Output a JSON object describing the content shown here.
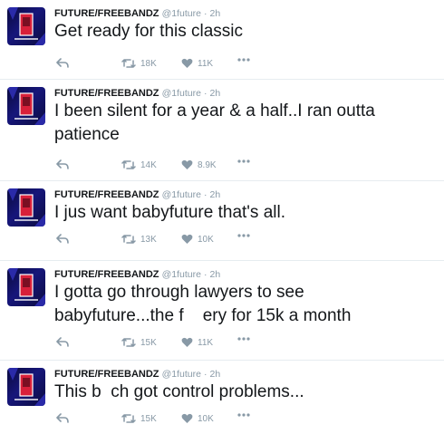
{
  "tweets": [
    {
      "name": "FUTURE/FREEBANDZ",
      "handle": "@1future",
      "separator": "·",
      "time": "2h",
      "text": "Get ready for this classic",
      "retweets": "18K",
      "likes": "11K"
    },
    {
      "name": "FUTURE/FREEBANDZ",
      "handle": "@1future",
      "separator": "·",
      "time": "2h",
      "text": "I been silent for a year & a half..I ran outta\npatience",
      "retweets": "14K",
      "likes": "8.9K"
    },
    {
      "name": "FUTURE/FREEBANDZ",
      "handle": "@1future",
      "separator": "·",
      "time": "2h",
      "text": "I jus want babyfuture that's all.",
      "retweets": "13K",
      "likes": "10K"
    },
    {
      "name": "FUTURE/FREEBANDZ",
      "handle": "@1future",
      "separator": "·",
      "time": "2h",
      "text": "I gotta go through lawyers to see\nbabyfuture...the f    ery for 15k a month",
      "retweets": "15K",
      "likes": "11K"
    },
    {
      "name": "FUTURE/FREEBANDZ",
      "handle": "@1future",
      "separator": "·",
      "time": "2h",
      "text": "This b  ch got control problems...",
      "retweets": "15K",
      "likes": "10K"
    }
  ],
  "colors": {
    "name": "#14171a",
    "meta": "#8899a6",
    "divider": "#e6ecf0",
    "avatar_bg": "#16167a",
    "avatar_accent": "#d8203a"
  },
  "icons": {
    "reply": "reply-icon",
    "retweet": "retweet-icon",
    "like": "heart-icon",
    "more": "more-icon"
  }
}
